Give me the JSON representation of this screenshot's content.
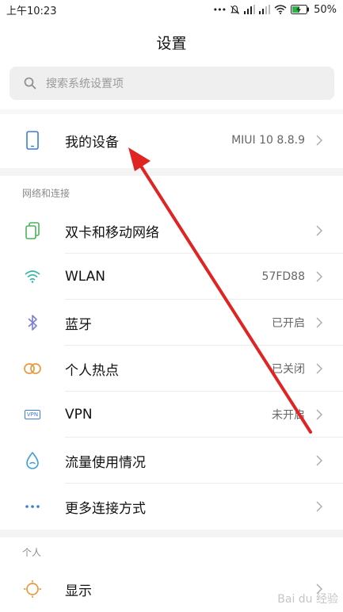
{
  "status": {
    "time": "上午10:23",
    "battery": "50%",
    "dots": "•••"
  },
  "title": "设置",
  "search": {
    "placeholder": "搜索系统设置项"
  },
  "device": {
    "label": "我的设备",
    "value": "MIUI 10 8.8.9"
  },
  "sections": {
    "network": "网络和连接",
    "personal": "个人"
  },
  "network_items": [
    {
      "label": "双卡和移动网络",
      "value": ""
    },
    {
      "label": "WLAN",
      "value": "57FD88"
    },
    {
      "label": "蓝牙",
      "value": "已开启"
    },
    {
      "label": "个人热点",
      "value": "已关闭"
    },
    {
      "label": "VPN",
      "value": "未开启"
    },
    {
      "label": "流量使用情况",
      "value": ""
    },
    {
      "label": "更多连接方式",
      "value": ""
    }
  ],
  "personal_items": [
    {
      "label": "显示",
      "value": ""
    }
  ],
  "vpn_badge": "VPN",
  "watermark": "Bai du 经验",
  "colors": {
    "accent_green": "#4cb25b",
    "accent_blue": "#3c7cd9",
    "arrow_red": "#e02424"
  }
}
